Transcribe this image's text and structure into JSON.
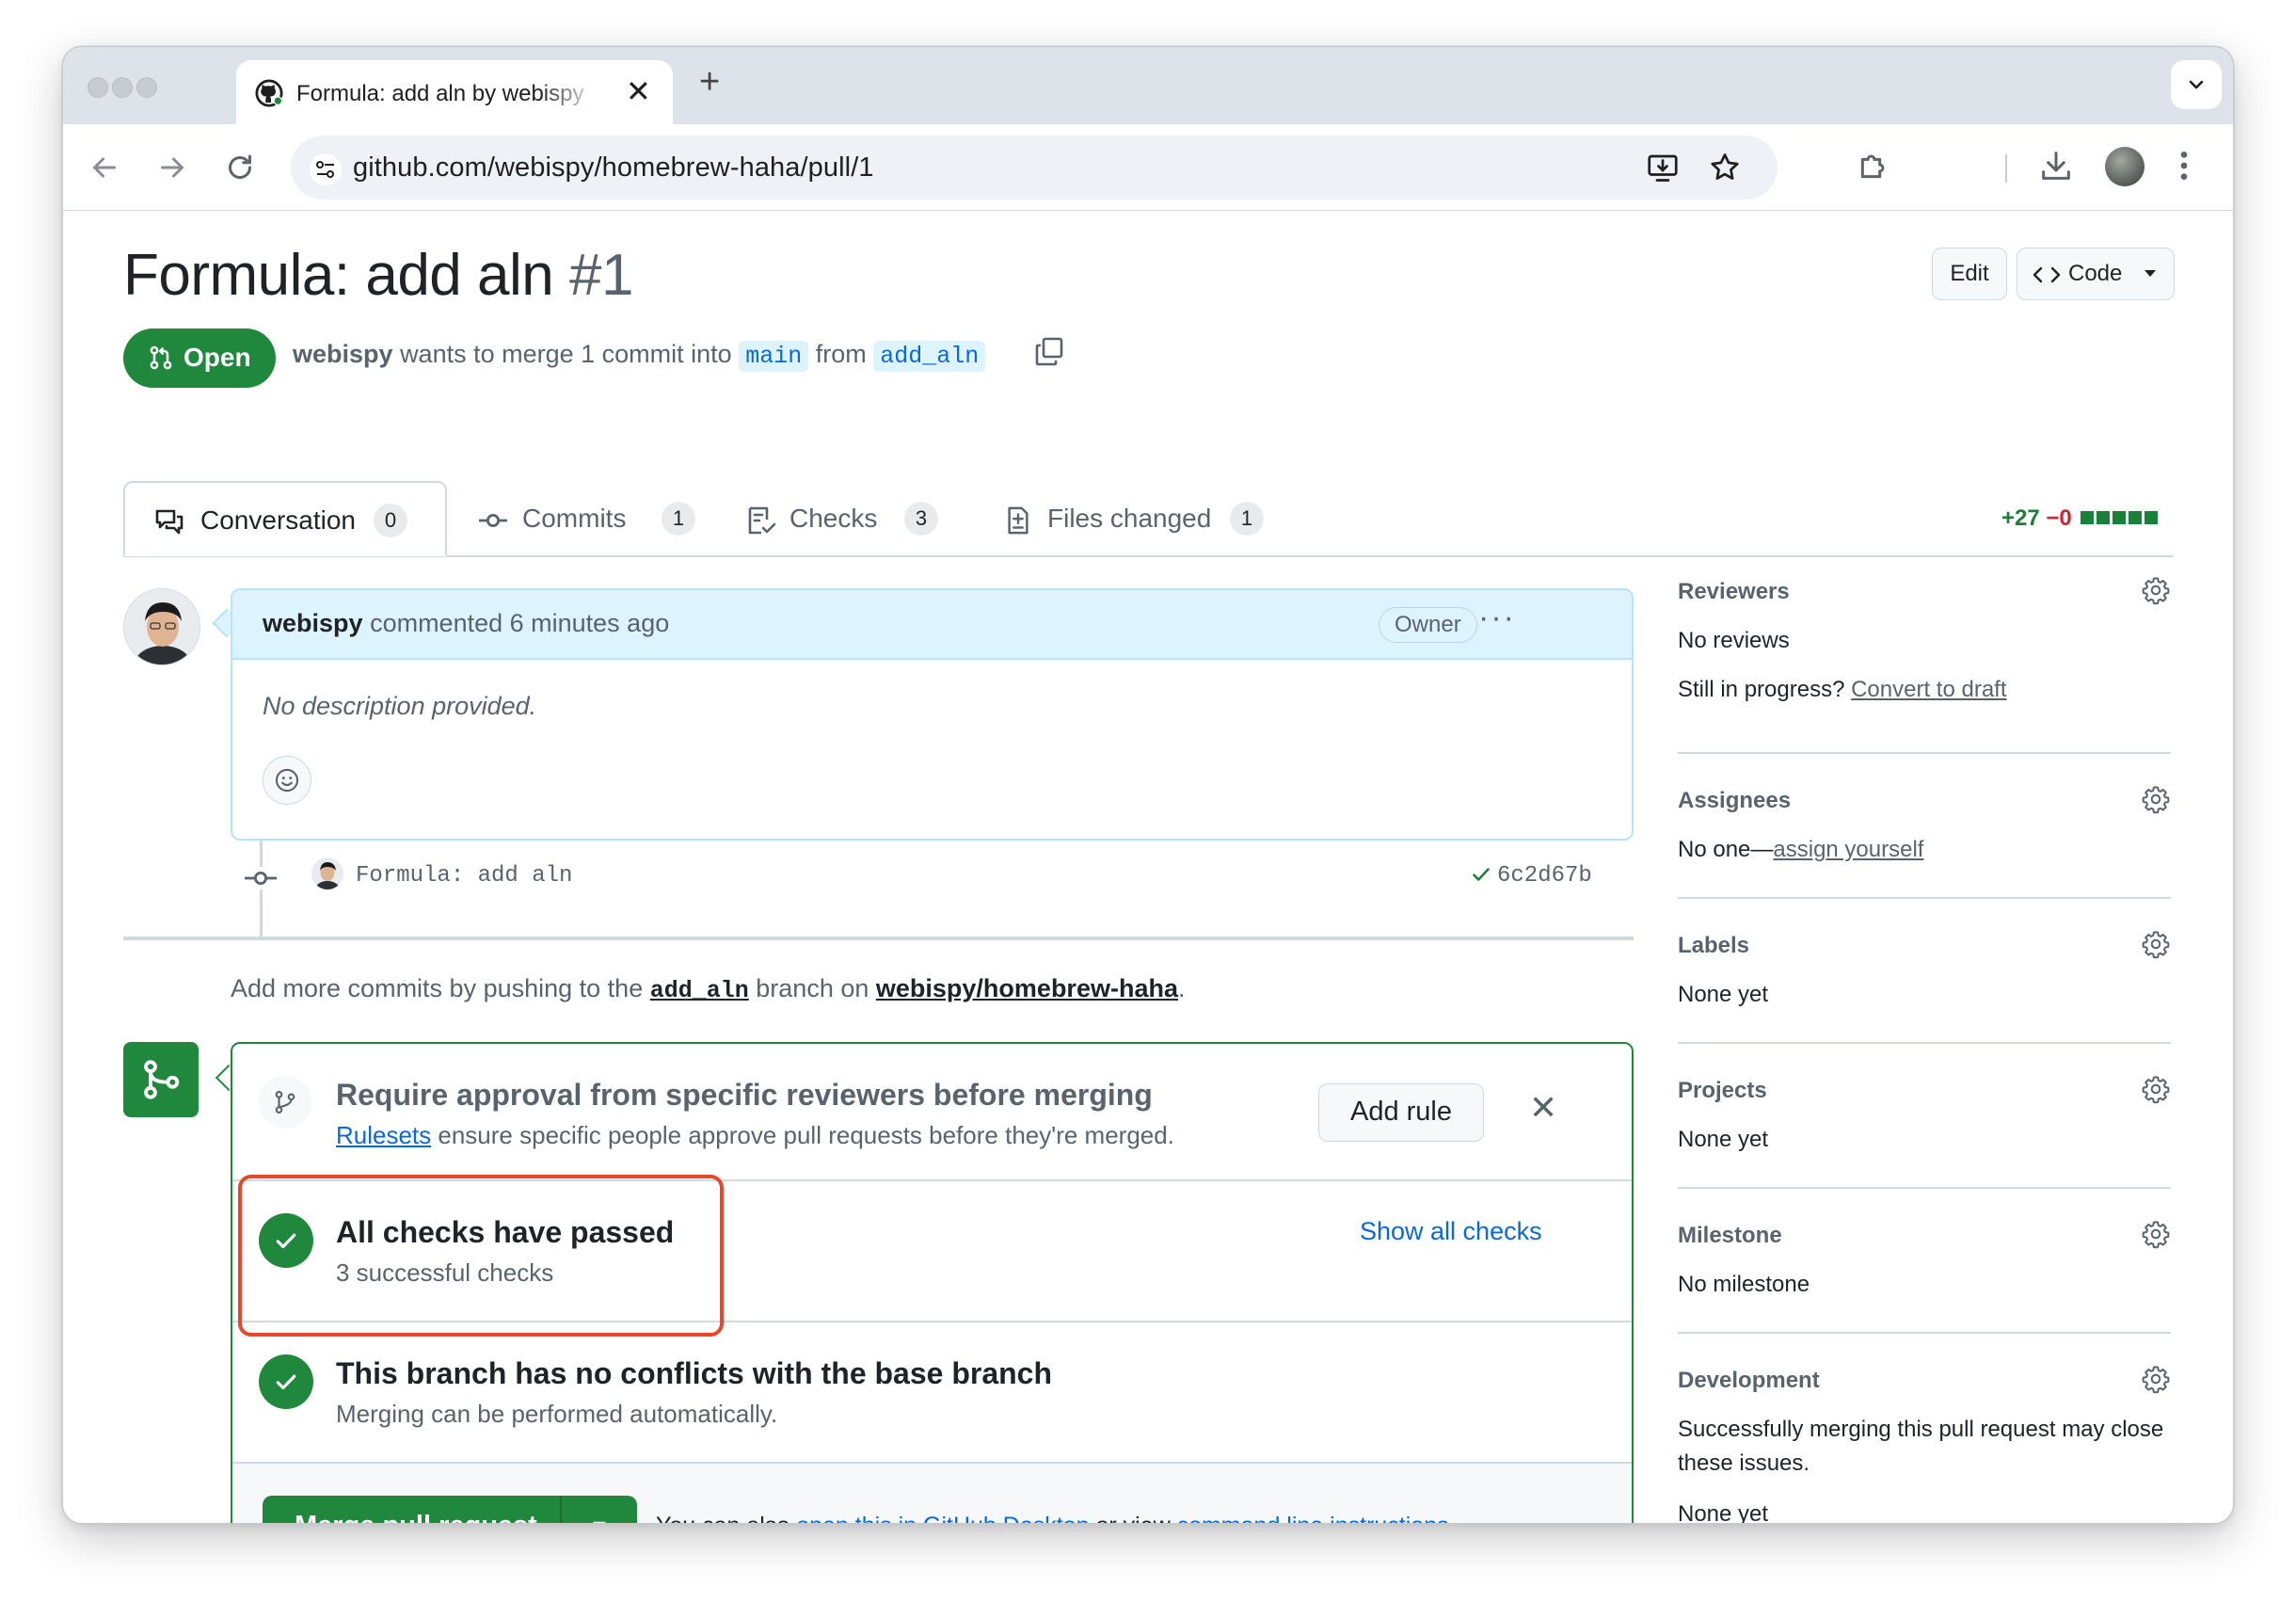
{
  "browser": {
    "tab_title": "Formula: add aln by webispy",
    "tab_close": "✕",
    "new_tab": "+",
    "url": "github.com/webispy/homebrew-haha/pull/1"
  },
  "pr": {
    "title": "Formula: add aln",
    "number": "#1",
    "state": "Open",
    "author": "webispy",
    "meta_mid": "wants to merge 1 commit into",
    "base_branch": "main",
    "meta_from": "from",
    "head_branch": "add_aln",
    "edit_label": "Edit",
    "code_label": "Code"
  },
  "tabs": [
    {
      "label": "Conversation",
      "count": "0",
      "icon": "comment-discussion-icon"
    },
    {
      "label": "Commits",
      "count": "1",
      "icon": "git-commit-icon"
    },
    {
      "label": "Checks",
      "count": "3",
      "icon": "checklist-icon"
    },
    {
      "label": "Files changed",
      "count": "1",
      "icon": "file-diff-icon"
    }
  ],
  "diffstat": {
    "additions": "+27",
    "deletions": "−0",
    "blocks": 5
  },
  "comment": {
    "author": "webispy",
    "action": "commented 6 minutes ago",
    "badge": "Owner",
    "more": "···",
    "body": "No description provided."
  },
  "commit": {
    "message": "Formula: add aln",
    "sha": "6c2d67b"
  },
  "push_hint": {
    "prefix": "Add more commits by pushing to the",
    "branch": "add_aln",
    "middle": "branch on",
    "repo": "webispy/homebrew-haha",
    "suffix": "."
  },
  "merge": {
    "rule_title": "Require approval from specific reviewers before merging",
    "rule_link": "Rulesets",
    "rule_desc": "ensure specific people approve pull requests before they're merged.",
    "add_rule": "Add rule",
    "dismiss": "✕",
    "checks_title": "All checks have passed",
    "checks_sub": "3 successful checks",
    "show_checks": "Show all checks",
    "conflict_title": "This branch has no conflicts with the base branch",
    "conflict_sub": "Merging can be performed automatically.",
    "merge_button": "Merge pull request",
    "alt_prefix": "You can also",
    "alt_link1": "open this in GitHub Desktop",
    "alt_mid": "or view",
    "alt_link2": "command line instructions",
    "alt_suffix": "."
  },
  "sidebar": {
    "reviewers": {
      "heading": "Reviewers",
      "value": "No reviews",
      "progress_q": "Still in progress?",
      "progress_link": "Convert to draft"
    },
    "assignees": {
      "heading": "Assignees",
      "value_prefix": "No one—",
      "value_link": "assign yourself"
    },
    "labels": {
      "heading": "Labels",
      "value": "None yet"
    },
    "projects": {
      "heading": "Projects",
      "value": "None yet"
    },
    "milestone": {
      "heading": "Milestone",
      "value": "No milestone"
    },
    "development": {
      "heading": "Development",
      "line1": "Successfully merging this pull request may close",
      "line2": "these issues.",
      "value": "None yet"
    }
  },
  "colors": {
    "accent_green": "#1f883d",
    "link_blue": "#0969da",
    "highlight_red": "#e5482a",
    "comment_header_bg": "#ddf4ff"
  }
}
